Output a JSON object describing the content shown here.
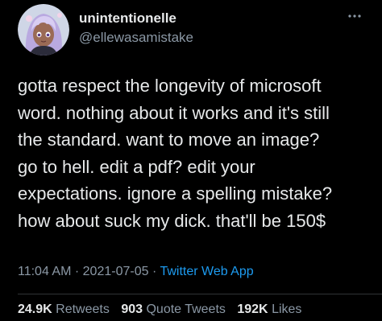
{
  "user": {
    "display_name": "unintentionelle",
    "handle": "@ellewasamistake",
    "avatar_icon": "anime-avatar"
  },
  "tweet": {
    "lines": [
      "gotta respect the longevity of microsoft",
      "word. nothing about it works and it's still",
      "the standard. want to move an image?",
      "go to hell. edit a pdf? edit your",
      "expectations. ignore a spelling mistake?",
      "how about suck my dick. that'll be 150$"
    ]
  },
  "meta": {
    "time": "11:04 AM",
    "separator": "·",
    "date": "2021-07-05",
    "source": "Twitter Web App"
  },
  "stats": {
    "retweets_count": "24.9K",
    "retweets_label": "Retweets",
    "quotes_count": "903",
    "quotes_label": "Quote Tweets",
    "likes_count": "192K",
    "likes_label": "Likes"
  },
  "colors": {
    "background": "#000000",
    "text": "#e7e9ea",
    "secondary": "#8b98a5",
    "link": "#1d9bf0"
  }
}
